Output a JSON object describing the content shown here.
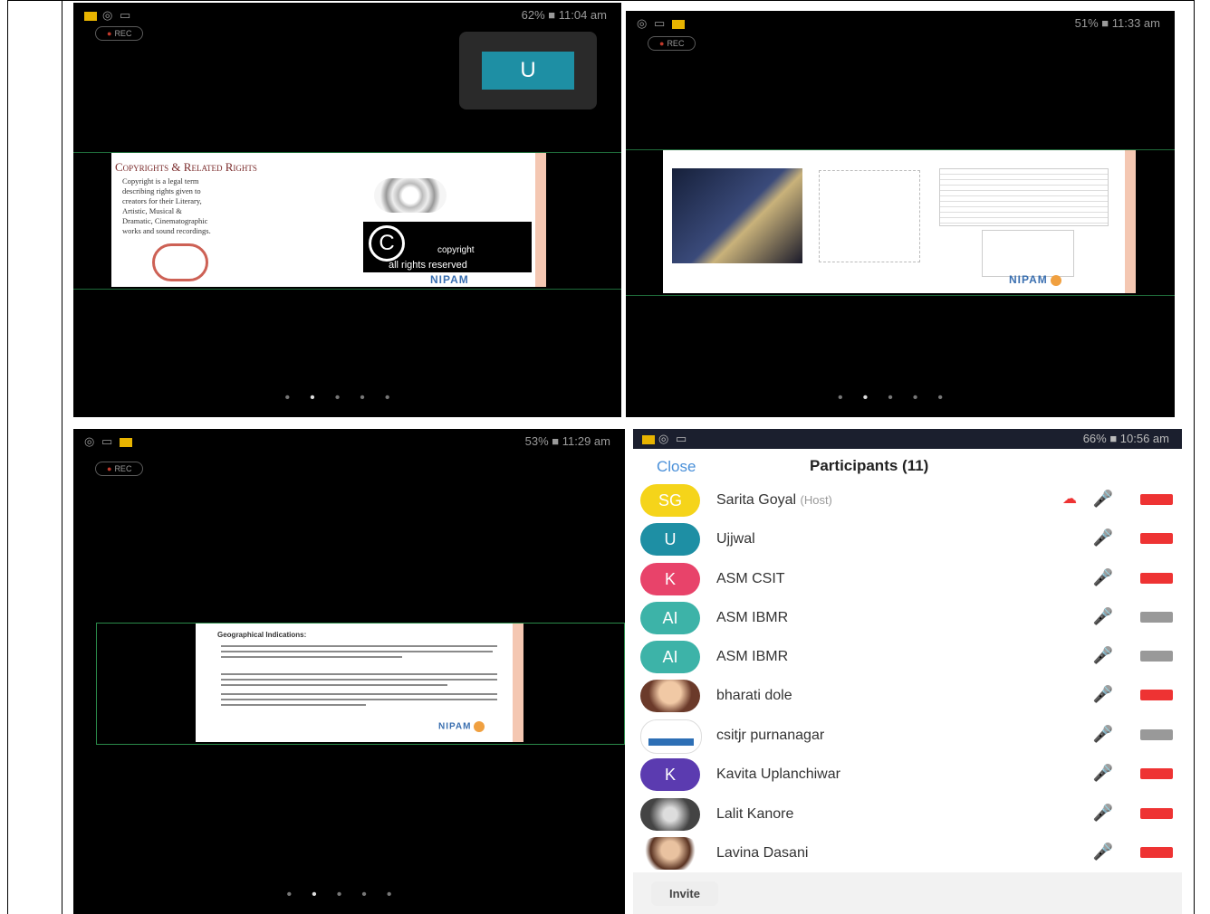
{
  "panels": {
    "p1": {
      "status_right": "62% ■ 11:04 am",
      "rec": "REC",
      "tile": "U",
      "slide_title": "Copyrights & Related Rights",
      "slide_lines": [
        "Copyright is a legal term",
        "describing rights given to",
        "creators for their Literary,",
        "Artistic, Musical &",
        "Dramatic, Cinematographic",
        "works and sound recordings."
      ],
      "badge_text": "copyright",
      "badge_sub": "all rights reserved",
      "logo": "NIPAM"
    },
    "p2": {
      "status_right": "51% ■ 11:33 am",
      "rec": "REC",
      "logo": "NIPAM"
    },
    "p3": {
      "status_right": "53% ■ 11:29 am",
      "rec": "REC",
      "slide_title": "Geographical Indications:",
      "logo": "NIPAM"
    },
    "p4": {
      "status_right": "66% ■ 10:56 am",
      "close": "Close",
      "title": "Participants (11)",
      "invite": "Invite",
      "participants": [
        {
          "initials": "SG",
          "name": "Sarita Goyal",
          "tag": "(Host)",
          "color": "#f5d41a",
          "cam": "on",
          "cloud": true
        },
        {
          "initials": "U",
          "name": "Ujjwal",
          "tag": "",
          "color": "#1e8fa4",
          "cam": "on",
          "mic": "on"
        },
        {
          "initials": "K",
          "name": "ASM CSIT",
          "tag": "",
          "color": "#e8436a",
          "cam": "on"
        },
        {
          "initials": "AI",
          "name": "ASM IBMR",
          "tag": "",
          "color": "#3db3a8",
          "cam": "off"
        },
        {
          "initials": "AI",
          "name": "ASM IBMR",
          "tag": "",
          "color": "#3db3a8",
          "cam": "off"
        },
        {
          "initials": "",
          "name": "bharati dole",
          "tag": "",
          "color": "#d7a08a",
          "cam": "on"
        },
        {
          "initials": "",
          "name": "csitjr purnanagar",
          "tag": "",
          "color": "#2d6fb5",
          "cam": "off"
        },
        {
          "initials": "K",
          "name": "Kavita Uplanchiwar",
          "tag": "",
          "color": "#5b3bb0",
          "cam": "on"
        },
        {
          "initials": "",
          "name": "Lalit Kanore",
          "tag": "",
          "color": "#6b6b6b",
          "cam": "on"
        },
        {
          "initials": "",
          "name": "Lavina Dasani",
          "tag": "",
          "color": "#8a5a40",
          "cam": "on"
        }
      ]
    }
  }
}
